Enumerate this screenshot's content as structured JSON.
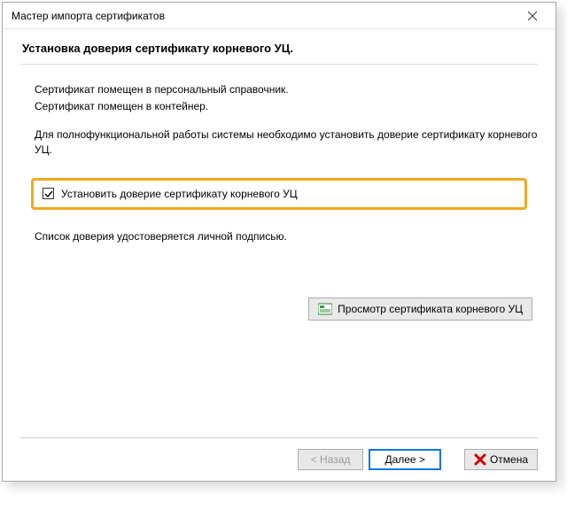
{
  "window": {
    "title": "Мастер импорта сертификатов"
  },
  "heading": "Установка доверия сертификату корневого УЦ.",
  "body": {
    "line1": "Сертификат помещен в персональный справочник.",
    "line2": "Сертификат помещен в контейнер.",
    "line3": "Для полнофункциональной работы системы необходимо установить доверие сертификату корневого УЦ."
  },
  "checkbox": {
    "label": "Установить доверие сертификату корневого УЦ",
    "checked": true
  },
  "note": "Список доверия удостоверяется личной подписью.",
  "buttons": {
    "view_cert": "Просмотр сертификата корневого УЦ",
    "back": "< Назад",
    "next": "Далее >",
    "cancel": "Отмена"
  }
}
